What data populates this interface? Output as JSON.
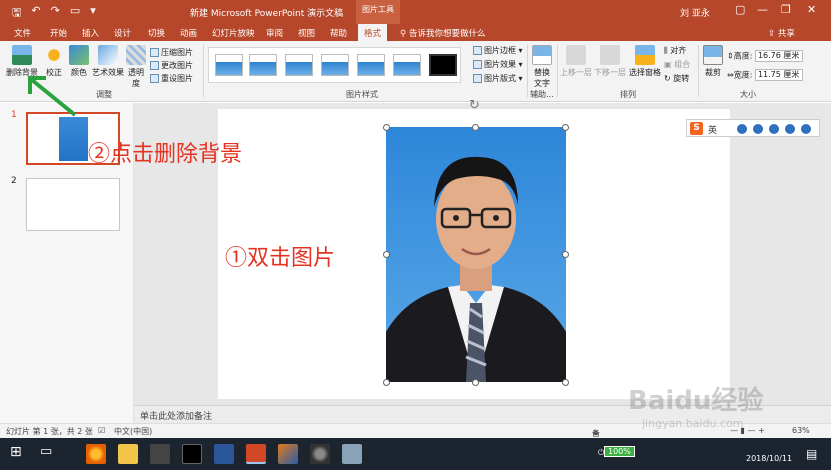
{
  "titlebar": {
    "doc_title": "新建 Microsoft PowerPoint 演示文稿",
    "tool_context": "图片工具",
    "user": "刘 亚永",
    "minimize": "—",
    "restore": "❐",
    "close": "✕"
  },
  "tabs": [
    "文件",
    "开始",
    "插入",
    "设计",
    "切换",
    "动画",
    "幻灯片放映",
    "审阅",
    "视图",
    "帮助",
    "格式"
  ],
  "tellme": "告诉我你想要做什么",
  "share": "共享",
  "ribbon": {
    "adjust": {
      "remove_bg": "删除背景",
      "correct": "校正",
      "color": "颜色",
      "art_effects": "艺术效果",
      "transparency_1": "透明",
      "transparency_2": "度",
      "compress": "压缩图片",
      "change": "更改图片",
      "reset": "重设图片",
      "label": "调整"
    },
    "styles": {
      "border": "图片边框",
      "effects": "图片效果",
      "layout": "图片版式",
      "label": "图片样式"
    },
    "aux": {
      "alt_text_1": "替换",
      "alt_text_2": "文字",
      "label": "辅助..."
    },
    "arrange": {
      "bring_forward": "上移一层",
      "send_backward": "下移一层",
      "selection_pane": "选择窗格",
      "align": "对齐",
      "group": "组合",
      "rotate": "旋转",
      "label": "排列"
    },
    "size": {
      "crop": "裁剪",
      "height_label": "高度:",
      "height_value": "16.76 厘米",
      "width_label": "宽度:",
      "width_value": "11.75 厘米",
      "label": "大小"
    }
  },
  "slides": [
    {
      "number": "1"
    },
    {
      "number": "2"
    }
  ],
  "annotations": {
    "step1": "①双击图片",
    "step2": "②点击删除背景"
  },
  "ime": {
    "english": "英"
  },
  "notes_placeholder": "单击此处添加备注",
  "statusbar": {
    "slide_info": "幻灯片 第 1 张，共 2 张",
    "language": "中文(中国)",
    "notes": "备注",
    "zoom": "63%"
  },
  "taskbar": {
    "battery": "100%",
    "date": "2018/10/11"
  },
  "watermark": {
    "brand": "Baidu经验",
    "url": "jingyan.baidu.com"
  }
}
